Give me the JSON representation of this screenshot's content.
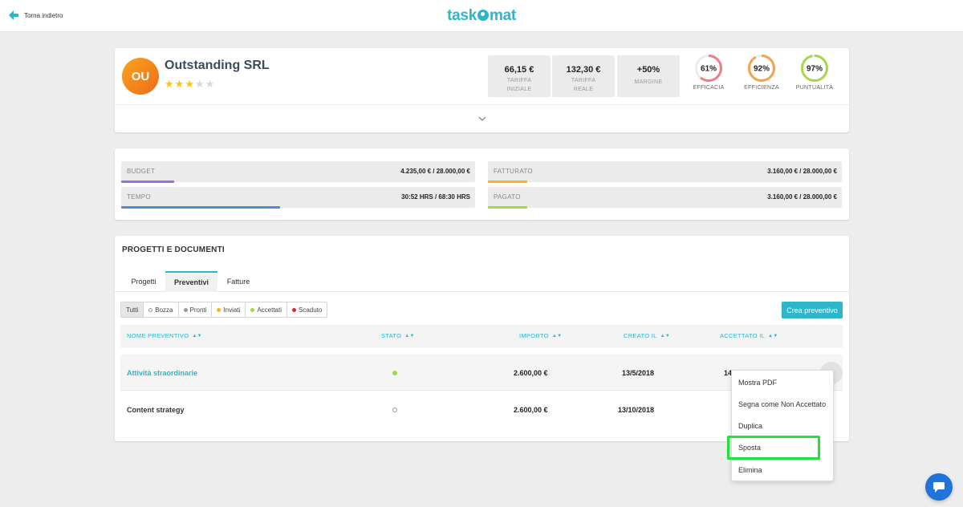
{
  "header": {
    "back_label": "Torna indietro",
    "logo_left": "task",
    "logo_right": "mat"
  },
  "client": {
    "initials": "OU",
    "name": "Outstanding SRL",
    "rating": 3,
    "rating_max": 5,
    "kpis": [
      {
        "value": "66,15 €",
        "label_1": "TARIFFA",
        "label_2": "INIZIALE"
      },
      {
        "value": "132,30 €",
        "label_1": "TARIFFA",
        "label_2": "REALE"
      },
      {
        "value": "+50%",
        "label_1": "MARGINE",
        "label_2": ""
      }
    ],
    "gauges": [
      {
        "value": "61%",
        "percent": 61,
        "label": "EFFICACIA",
        "color": "#ef7c86"
      },
      {
        "value": "92%",
        "percent": 92,
        "label": "EFFICIENZA",
        "color": "#f5a34a"
      },
      {
        "value": "97%",
        "percent": 97,
        "label": "PUNTUALITÀ",
        "color": "#a8d64a"
      }
    ]
  },
  "budget": {
    "bars": [
      {
        "label": "BUDGET",
        "value": "4.235,00 € / 28.000,00 €",
        "fill": 0.15,
        "color": "#9b6fe3"
      },
      {
        "label": "FATTURATO",
        "value": "3.160,00 € / 28.000,00 €",
        "fill": 0.11,
        "color": "#f5b61c"
      },
      {
        "label": "TEMPO",
        "value": "30:52 HRS / 68:30 HRS",
        "fill": 0.45,
        "color": "#4a8ad9"
      },
      {
        "label": "PAGATO",
        "value": "3.160,00 € / 28.000,00 €",
        "fill": 0.11,
        "color": "#a8d64a"
      }
    ]
  },
  "projects": {
    "title": "PROGETTI E DOCUMENTI",
    "tabs": [
      "Progetti",
      "Preventivi",
      "Fatture"
    ],
    "active_tab": "Preventivi",
    "filters": [
      {
        "label": "Tutti",
        "dot": ""
      },
      {
        "label": "Bozza",
        "dot": "hollow"
      },
      {
        "label": "Pronti",
        "dot": "#999999"
      },
      {
        "label": "Inviati",
        "dot": "#f5b61c"
      },
      {
        "label": "Accettati",
        "dot": "#a8d64a"
      },
      {
        "label": "Scaduto",
        "dot": "#d9262c"
      }
    ],
    "create_label": "Crea preventivo",
    "columns": [
      "NOME PREVENTIVO",
      "STATO",
      "IMPORTO",
      "CREATO IL",
      "ACCETTATO IL"
    ],
    "rows": [
      {
        "name": "Attività straordinarie",
        "status": "accepted",
        "amount": "2.600,00 €",
        "created": "13/5/2018",
        "accepted": "14/5/2018"
      },
      {
        "name": "Content strategy",
        "status": "draft",
        "amount": "2.600,00 €",
        "created": "13/10/2018",
        "accepted": ""
      }
    ]
  },
  "context_menu": {
    "items": [
      "Mostra PDF",
      "Segna come Non Accettato",
      "Duplica",
      "Sposta",
      "Elimina"
    ],
    "highlighted": "Sposta"
  },
  "colors": {
    "accent": "#2fb5c9",
    "highlight": "#22e13a",
    "chat": "#1f73d9"
  }
}
